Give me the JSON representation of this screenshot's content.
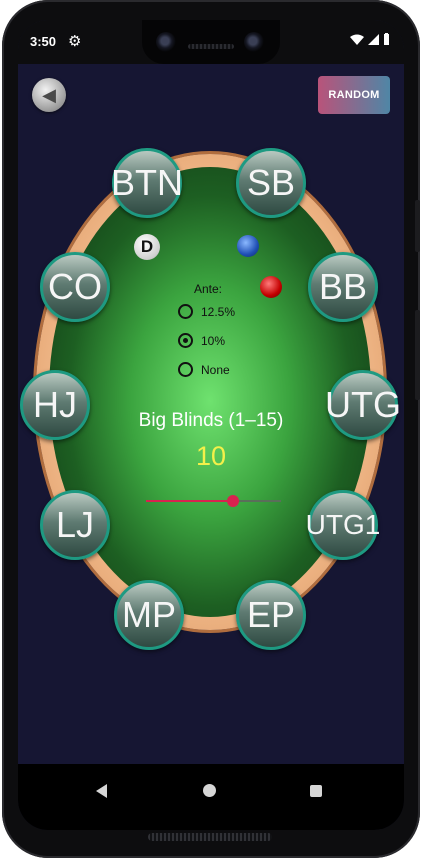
{
  "status_bar": {
    "time": "3:50",
    "settings_icon": "gear-icon",
    "icons": [
      "wifi-icon",
      "signal-icon",
      "battery-icon"
    ]
  },
  "toolbar": {
    "back_icon": "arrow-left-icon",
    "random_label": "RANDOM"
  },
  "table": {
    "dealer_label": "D",
    "seats": [
      "BTN",
      "SB",
      "BB",
      "UTG",
      "UTG1",
      "EP",
      "MP",
      "LJ",
      "HJ",
      "CO"
    ]
  },
  "ante": {
    "label": "Ante:",
    "options": [
      "12.5%",
      "10%",
      "None"
    ],
    "selected": "10%"
  },
  "big_blinds": {
    "label": "Big Blinds (1–15)",
    "value": "10",
    "min": 1,
    "max": 15,
    "current": 10
  },
  "colors": {
    "accent": "#d8234f",
    "value_text": "#f3f04a",
    "seat_border": "#1e9a82"
  },
  "nav_bar": {
    "icons": [
      "back-triangle-icon",
      "home-circle-icon",
      "recents-square-icon"
    ]
  }
}
